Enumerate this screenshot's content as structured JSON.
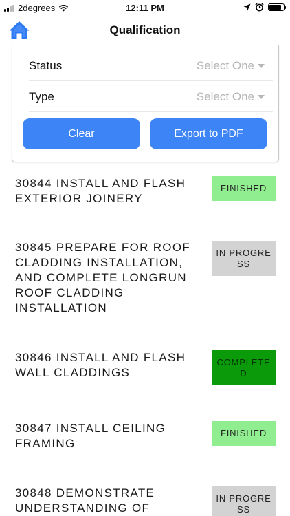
{
  "status_bar": {
    "carrier": "2degrees",
    "time": "12:11 PM",
    "battery_level": 0.85
  },
  "nav": {
    "title": "Qualification",
    "home_icon": "home-icon"
  },
  "filters": {
    "status_label": "Status",
    "status_value": "Select One",
    "type_label": "Type",
    "type_value": "Select One",
    "clear_label": "Clear",
    "export_label": "Export to PDF"
  },
  "colors": {
    "accent": "#3d84f6",
    "finished": "#90ee90",
    "in_progress": "#d3d3d3",
    "completed": "#0a9a0a"
  },
  "items": [
    {
      "title": "30844 INSTALL AND FLASH EXTERIOR JOINERY",
      "status": "FINISHED"
    },
    {
      "title": "30845 PREPARE FOR ROOF CLADDING INSTALLATION, AND COMPLETE LONGRUN ROOF CLADDING INSTALLATION",
      "status": "IN PROGRESS"
    },
    {
      "title": "30846 INSTALL AND FLASH WALL CLADDINGS",
      "status": "COMPLETED"
    },
    {
      "title": "30847 INSTALL CEILING FRAMING",
      "status": "FINISHED"
    },
    {
      "title": "30848 DEMONSTRATE UNDERSTANDING OF",
      "status": "IN PROGRESS"
    }
  ]
}
